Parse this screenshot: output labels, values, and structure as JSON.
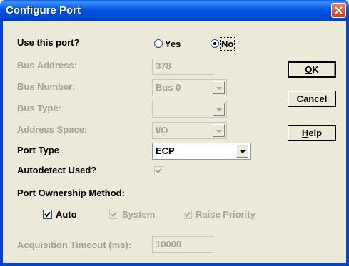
{
  "window": {
    "title": "Configure Port"
  },
  "use_port": {
    "label": "Use this port?",
    "options": [
      "Yes",
      "No"
    ],
    "selected": "No"
  },
  "fields": {
    "bus_address": {
      "label": "Bus Address:",
      "value": "378"
    },
    "bus_number": {
      "label": "Bus Number:",
      "value": "Bus 0"
    },
    "bus_type": {
      "label": "Bus Type:",
      "value": ""
    },
    "address_space": {
      "label": "Address Space:",
      "value": "I/O"
    },
    "port_type": {
      "label": "Port Type",
      "value": "ECP"
    },
    "autodetect": {
      "label": "Autodetect Used?",
      "checked": true
    }
  },
  "ownership": {
    "label": "Port Ownership Method:",
    "auto": {
      "label": "Auto",
      "checked": true
    },
    "system": {
      "label": "System",
      "checked": true
    },
    "raise_priority": {
      "label": "Raise Priority",
      "checked": true
    }
  },
  "timeout": {
    "label": "Acquisition Timeout (ms):",
    "value": "10000"
  },
  "buttons": {
    "ok": {
      "mnemonic": "O",
      "rest": "K"
    },
    "cancel": {
      "mnemonic": "C",
      "rest": "ancel"
    },
    "help": {
      "mnemonic": "H",
      "rest": "elp"
    }
  },
  "icons": {
    "close": "close-icon",
    "dropdown": "chevron-down-icon",
    "check": "checkmark-icon"
  }
}
